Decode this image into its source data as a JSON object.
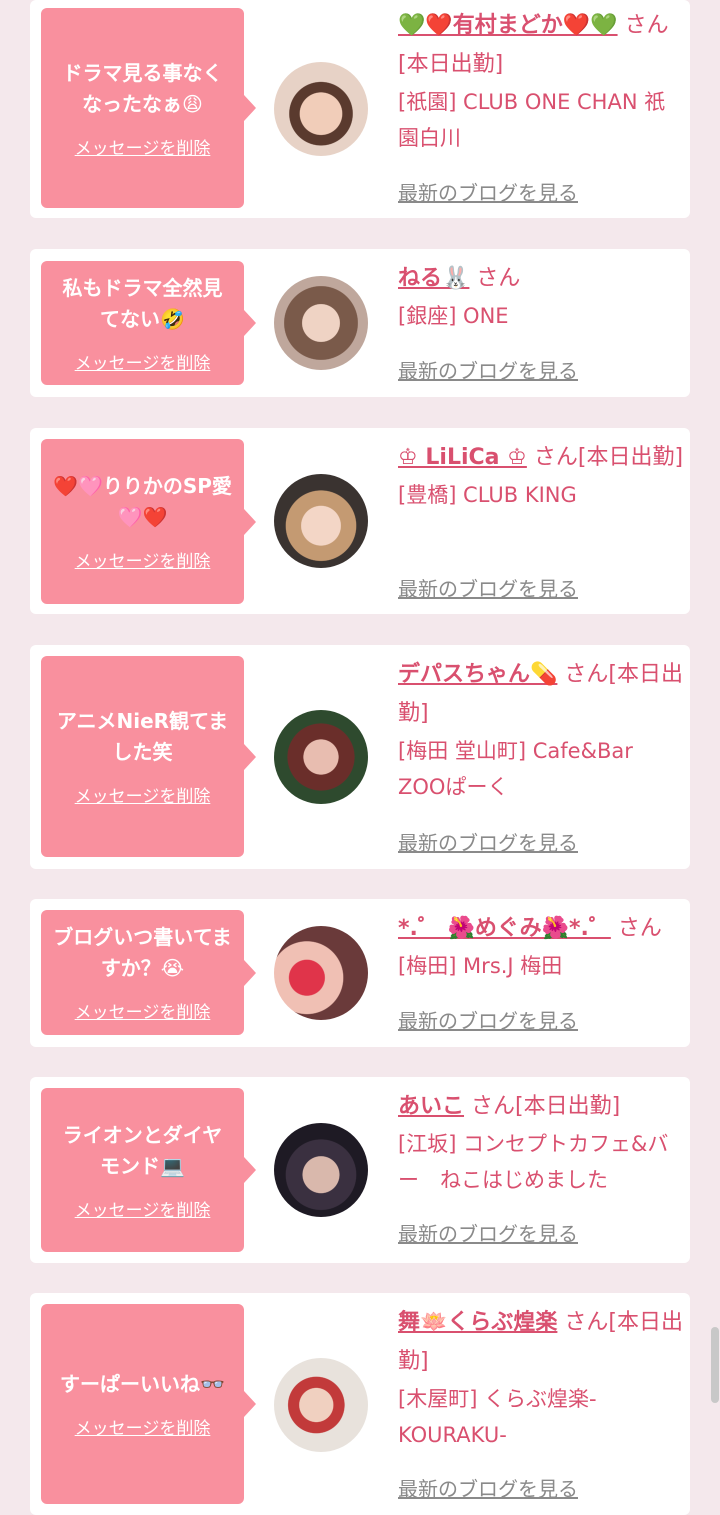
{
  "delete_label": "メッセージを削除",
  "blog_label": "最新のブログを見る",
  "colors": {
    "page_bg": "#f4e8ec",
    "card_bg": "#ffffff",
    "bubble_bg": "#f9909e",
    "accent_text": "#d9506f",
    "link_gray": "#8a8a8a"
  },
  "entries": [
    {
      "message": "ドラマ見る事なくなったなぁ😩",
      "name": "💚❤️有村まどか❤️💚",
      "suffix": "さん[本日出勤]",
      "shop": "[祇園] CLUB ONE CHAN 祇園白川"
    },
    {
      "message": "私もドラマ全然見てない🤣",
      "name": "ねる🐰",
      "suffix": "さん",
      "shop": "[銀座] ONE"
    },
    {
      "message": "❤️🩷りりかのSP愛🩷❤️",
      "name": "♔ LiLiCa ♔",
      "suffix": "さん[本日出勤]",
      "shop": "[豊橋] CLUB KING"
    },
    {
      "message": "アニメNieR観てました笑",
      "name": "デパスちゃん💊",
      "suffix": "さん[本日出勤]",
      "shop": "[梅田 堂山町] Cafe&Bar ZOOぱーく"
    },
    {
      "message": "ブログいつ書いてますか？😭",
      "name": "*.゜ 🌺めぐみ🌺*.゜",
      "suffix": "さん",
      "shop": "[梅田] Mrs.J 梅田"
    },
    {
      "message": "ライオンとダイヤモンド💻",
      "name": "あいこ",
      "suffix": "さん[本日出勤]",
      "shop": "[江坂] コンセプトカフェ&バー　ねこはじめました"
    },
    {
      "message": "すーぱーいいね👓",
      "name": "舞🪷くらぶ煌楽",
      "suffix": "さん[本日出勤]",
      "shop": "[木屋町] くらぶ煌楽-KOURAKU-"
    }
  ]
}
